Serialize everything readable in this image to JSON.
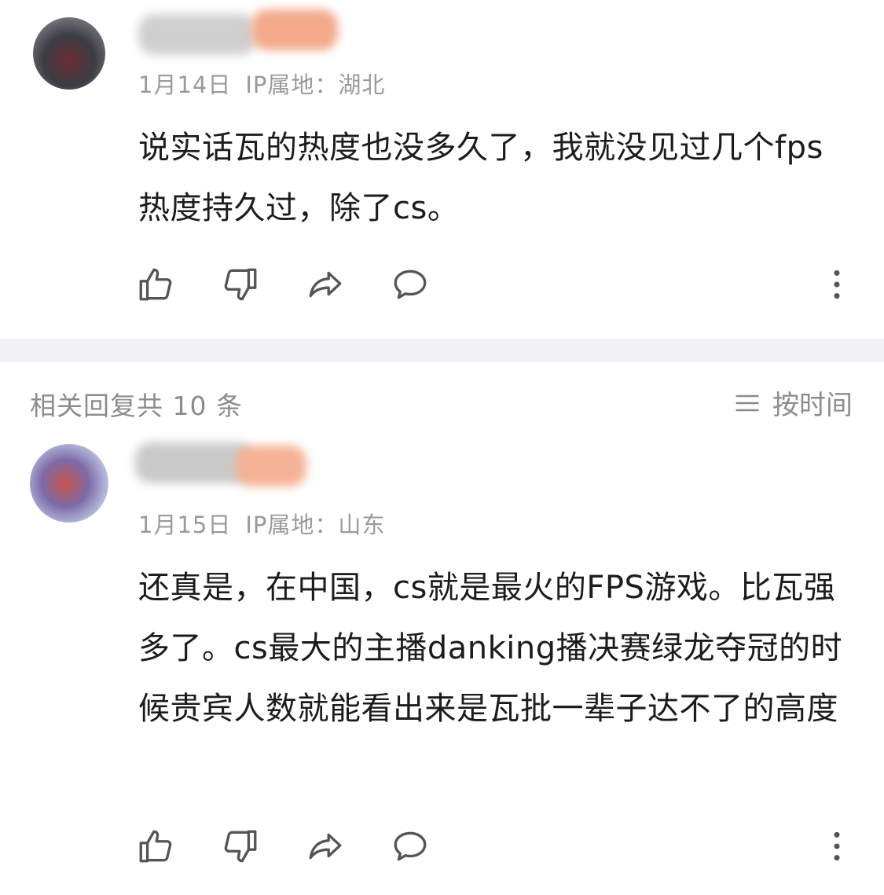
{
  "comments": [
    {
      "date": "1月14日",
      "ip_location": "IP属地：湖北",
      "text": "说实话瓦的热度也没多久了，我就没见过几个fps热度持久过，除了cs。"
    },
    {
      "date": "1月15日",
      "ip_location": "IP属地：山东",
      "text": "还真是，在中国，cs就是最火的FPS游戏。比瓦强多了。cs最大的主播danking播决赛绿龙夺冠的时候贵宾人数就能看出来是瓦批一辈子达不了的高度"
    }
  ],
  "replies_header": {
    "count_label": "相关回复共 10 条",
    "sort_label": "按时间"
  },
  "icons": {
    "like": "thumbs-up-icon",
    "dislike": "thumbs-down-icon",
    "share": "share-icon",
    "comment": "comment-icon",
    "more": "more-vertical-icon",
    "sort": "sort-lines-icon"
  },
  "colors": {
    "text": "#1c1c1c",
    "meta": "#9a9a9a",
    "icon": "#555555",
    "divider": "#f1f1f3"
  }
}
